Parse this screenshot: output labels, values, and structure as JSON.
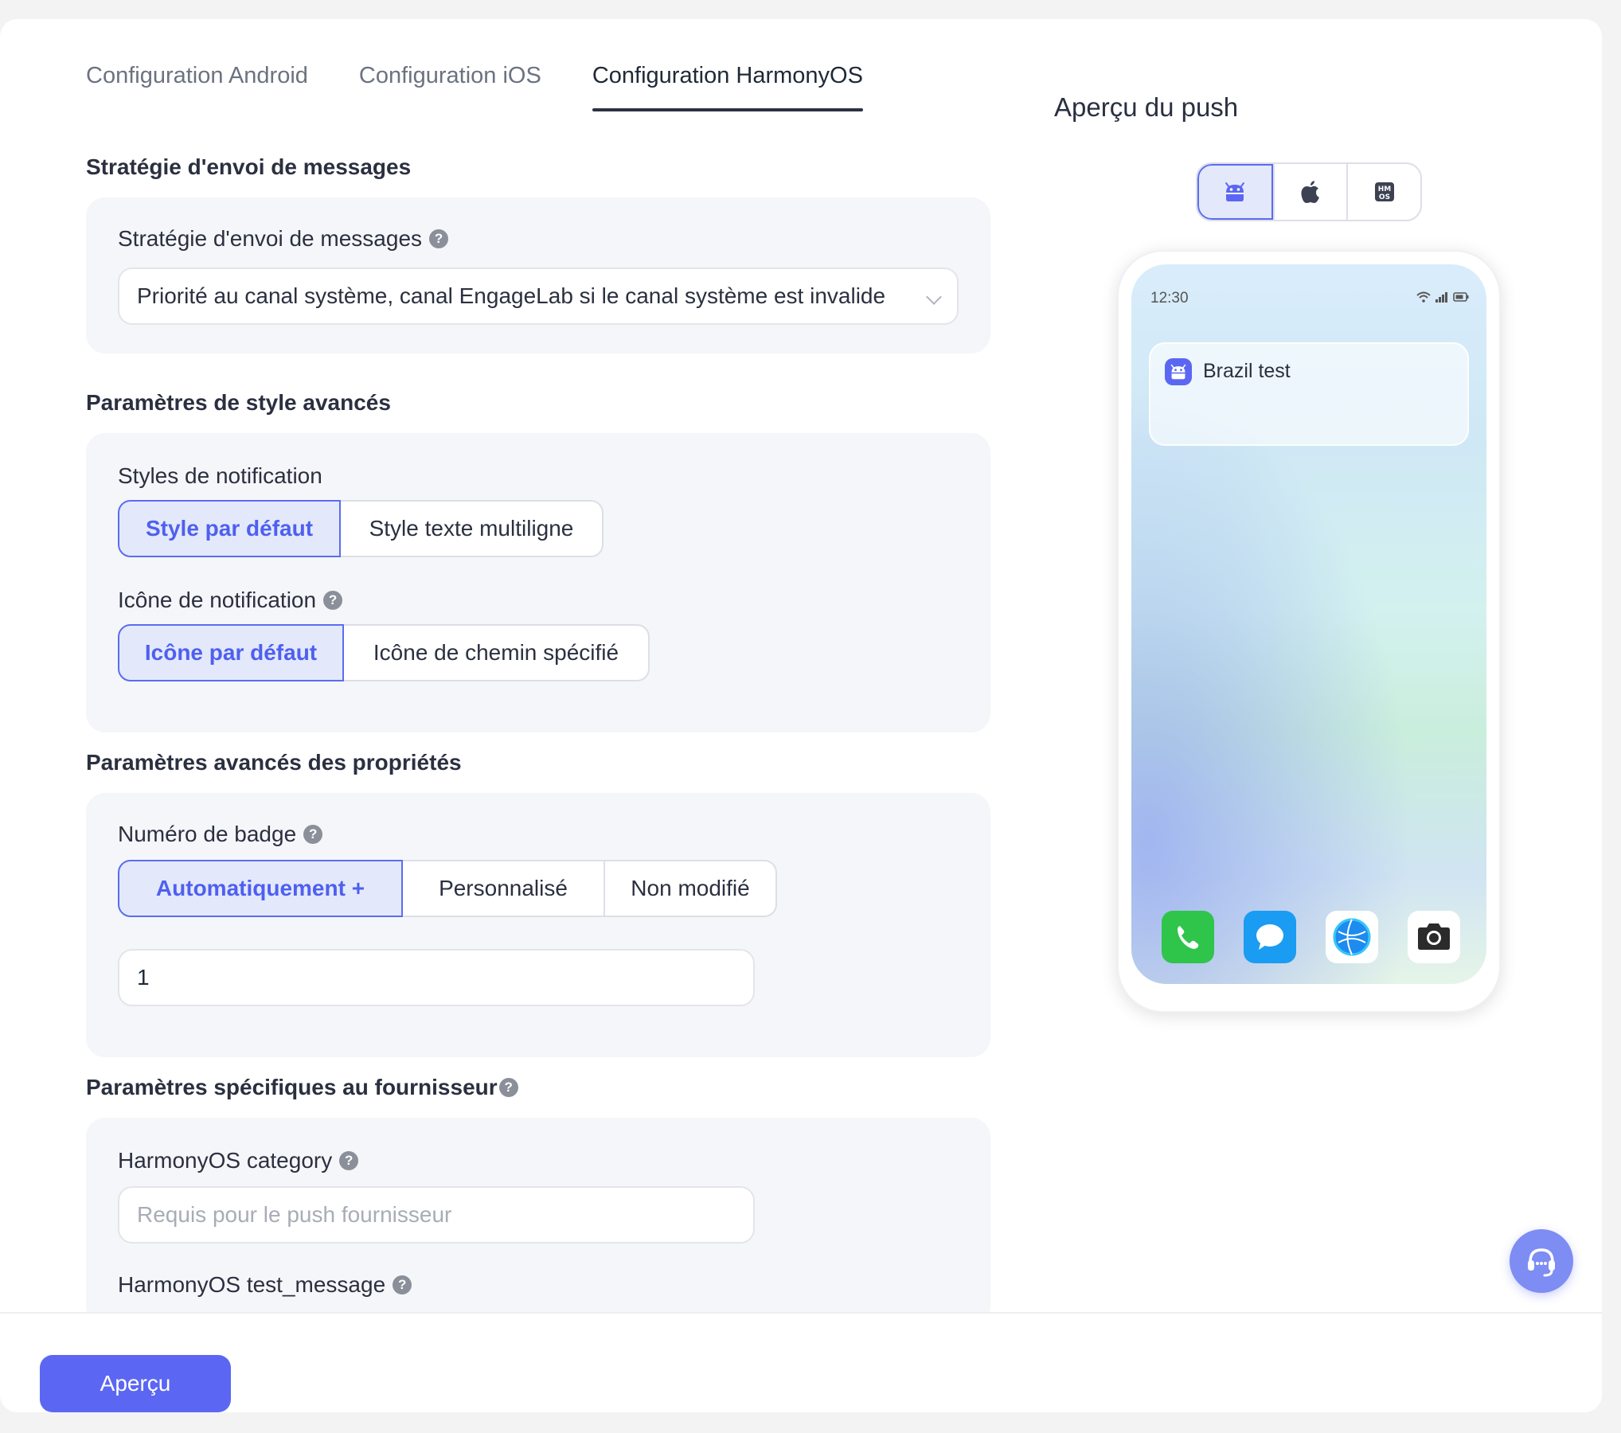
{
  "tabs": [
    {
      "label": "Configuration Android"
    },
    {
      "label": "Configuration iOS"
    },
    {
      "label": "Configuration HarmonyOS"
    }
  ],
  "sections": {
    "strategy": {
      "title": "Stratégie d'envoi de messages",
      "label": "Stratégie d'envoi de messages",
      "value": "Priorité au canal système, canal EngageLab si le canal système est invalide"
    },
    "style": {
      "title": "Paramètres de style avancés",
      "notif_style_label": "Styles de notification",
      "notif_style_options": [
        "Style par défaut",
        "Style texte multiligne"
      ],
      "notif_icon_label": "Icône de notification",
      "notif_icon_options": [
        "Icône par défaut",
        "Icône de chemin spécifié"
      ]
    },
    "props": {
      "title": "Paramètres avancés des propriétés",
      "badge_label": "Numéro de badge",
      "badge_options": [
        "Automatiquement +",
        "Personnalisé",
        "Non modifié"
      ],
      "badge_value": "1"
    },
    "vendor": {
      "title": "Paramètres spécifiques au fournisseur",
      "category_label": "HarmonyOS category",
      "category_placeholder": "Requis pour le push fournisseur",
      "test_message_label": "HarmonyOS test_message"
    }
  },
  "help_glyph": "?",
  "footer": {
    "preview_button": "Aperçu"
  },
  "preview": {
    "title": "Aperçu du push",
    "os_options": [
      "android-icon",
      "apple-icon",
      "hmos-icon"
    ],
    "phone": {
      "time": "12:30",
      "notification_title": "Brazil test",
      "dock_apps": [
        "phone-icon",
        "messages-icon",
        "browser-icon",
        "camera-icon"
      ]
    }
  },
  "colors": {
    "accent": "#5b67f2",
    "accent_bg": "#e3e9fb",
    "panel_bg": "#f5f6f9"
  }
}
